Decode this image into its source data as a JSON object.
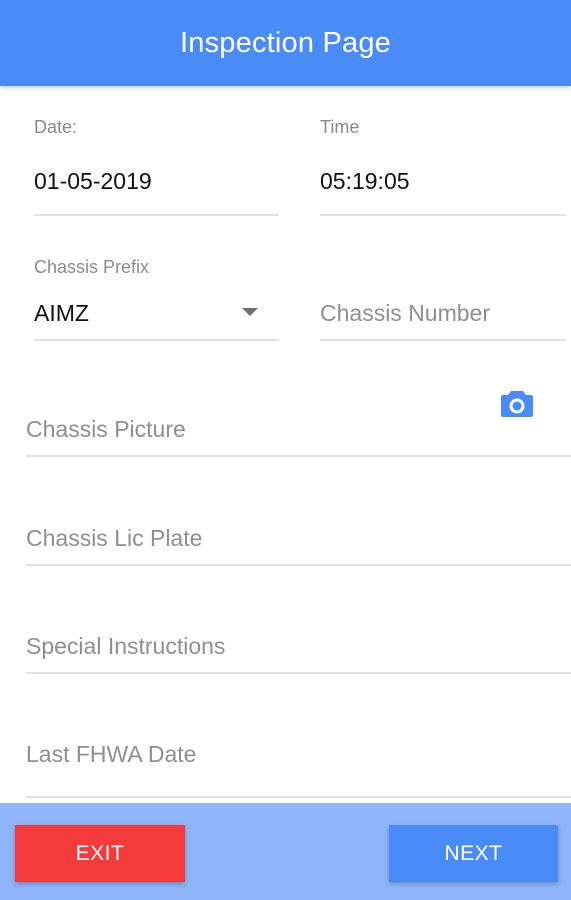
{
  "header": {
    "title": "Inspection Page"
  },
  "form": {
    "date": {
      "label": "Date:",
      "value": "01-05-2019"
    },
    "time": {
      "label": "Time",
      "value": "05:19:05"
    },
    "chassis_prefix": {
      "label": "Chassis Prefix",
      "value": "AIMZ"
    },
    "chassis_number": {
      "placeholder": "Chassis Number"
    },
    "chassis_picture": {
      "placeholder": "Chassis Picture",
      "icon": "camera-icon"
    },
    "chassis_lic_plate": {
      "placeholder": "Chassis Lic Plate"
    },
    "special_instructions": {
      "placeholder": "Special Instructions"
    },
    "last_fhwa_date": {
      "placeholder": "Last FHWA Date"
    }
  },
  "footer": {
    "exit_label": "EXIT",
    "next_label": "NEXT"
  },
  "colors": {
    "primary": "#4a8cf7",
    "footer_bg": "#8fb4fa",
    "exit": "#f33b3b"
  }
}
